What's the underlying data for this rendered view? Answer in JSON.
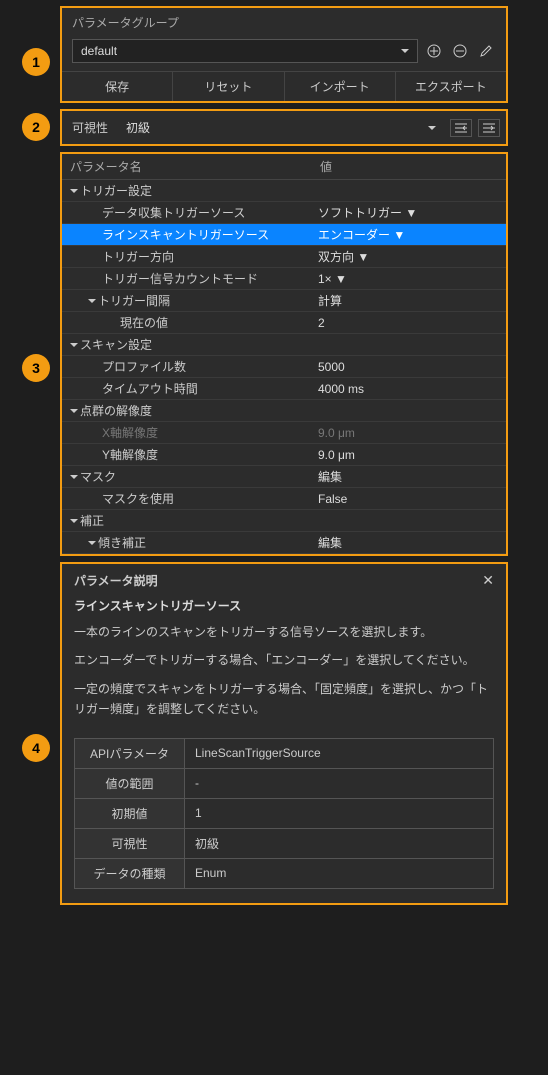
{
  "badges": {
    "b1": "1",
    "b2": "2",
    "b3": "3",
    "b4": "4"
  },
  "group": {
    "label": "パラメータグループ",
    "selected": "default",
    "buttons": {
      "save": "保存",
      "reset": "リセット",
      "import": "インポート",
      "export": "エクスポート"
    }
  },
  "visibility": {
    "label": "可視性",
    "value": "初級"
  },
  "params": {
    "header_name": "パラメータ名",
    "header_value": "値",
    "rows": [
      {
        "depth": 0,
        "expand": true,
        "name": "トリガー設定",
        "value": "",
        "hl": false
      },
      {
        "depth": 1,
        "expand": false,
        "name": "データ収集トリガーソース",
        "value": "ソフトトリガー ▼",
        "hl": false
      },
      {
        "depth": 1,
        "expand": false,
        "name": "ラインスキャントリガーソース",
        "value": "エンコーダー ▼",
        "hl": true
      },
      {
        "depth": 1,
        "expand": false,
        "name": "トリガー方向",
        "value": "双方向 ▼",
        "hl": false
      },
      {
        "depth": 1,
        "expand": false,
        "name": "トリガー信号カウントモード",
        "value": "1× ▼",
        "hl": false
      },
      {
        "depth": 1,
        "expand": true,
        "name": "トリガー間隔",
        "value": "計算",
        "hl": false
      },
      {
        "depth": 2,
        "expand": false,
        "name": "現在の値",
        "value": "2",
        "hl": false
      },
      {
        "depth": 0,
        "expand": true,
        "name": "スキャン設定",
        "value": "",
        "hl": false
      },
      {
        "depth": 1,
        "expand": false,
        "name": "プロファイル数",
        "value": "5000",
        "hl": false
      },
      {
        "depth": 1,
        "expand": false,
        "name": "タイムアウト時間",
        "value": "4000 ms",
        "hl": false
      },
      {
        "depth": 0,
        "expand": true,
        "name": "点群の解像度",
        "value": "",
        "hl": false
      },
      {
        "depth": 1,
        "expand": false,
        "name": "X軸解像度",
        "value": "9.0 μm",
        "hl": false,
        "dim": true
      },
      {
        "depth": 1,
        "expand": false,
        "name": "Y軸解像度",
        "value": "9.0 μm",
        "hl": false
      },
      {
        "depth": 0,
        "expand": true,
        "name": "マスク",
        "value": "編集",
        "hl": false
      },
      {
        "depth": 1,
        "expand": false,
        "name": "マスクを使用",
        "value": "False",
        "hl": false
      },
      {
        "depth": 0,
        "expand": true,
        "name": "補正",
        "value": "",
        "hl": false
      },
      {
        "depth": 1,
        "expand": true,
        "name": "傾き補正",
        "value": "編集",
        "hl": false
      }
    ]
  },
  "desc": {
    "title": "パラメータ説明",
    "subtitle": "ラインスキャントリガーソース",
    "para1": "一本のラインのスキャンをトリガーする信号ソースを選択します。",
    "para2": "エンコーダーでトリガーする場合、「エンコーダー」を選択してください。",
    "para3": "一定の頻度でスキャンをトリガーする場合、「固定頻度」を選択し、かつ「トリガー頻度」を調整してください。",
    "table": {
      "api_k": "APIパラメータ",
      "api_v": "LineScanTriggerSource",
      "range_k": "値の範囲",
      "range_v": "-",
      "default_k": "初期値",
      "default_v": "1",
      "vis_k": "可視性",
      "vis_v": "初級",
      "type_k": "データの種類",
      "type_v": "Enum"
    }
  }
}
